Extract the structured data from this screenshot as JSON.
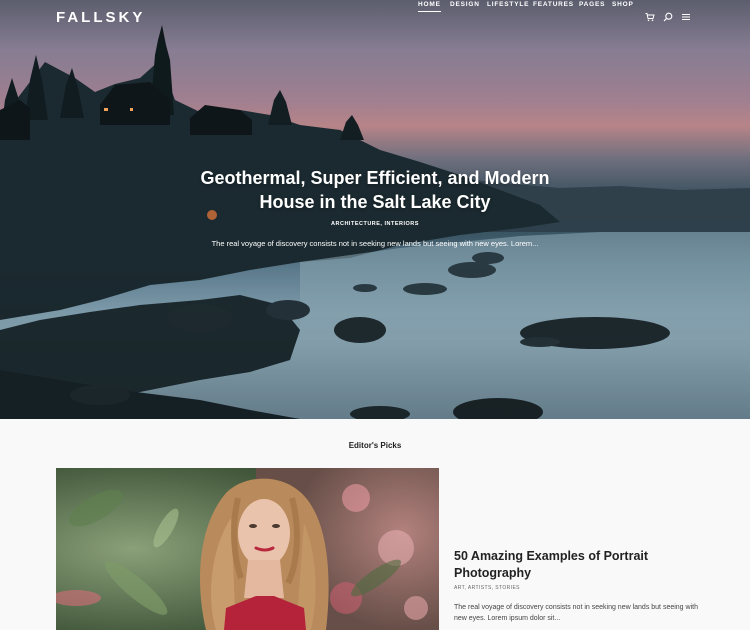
{
  "header": {
    "logo": "FALLSKY",
    "nav": [
      {
        "label": "HOME",
        "active": true
      },
      {
        "label": "DESIGN",
        "active": false
      },
      {
        "label": "LIFESTYLE",
        "active": false
      },
      {
        "label": "FEATURES",
        "active": false
      },
      {
        "label": "PAGES",
        "active": false
      },
      {
        "label": "SHOP",
        "active": false
      }
    ],
    "icons": [
      "cart-icon",
      "search-icon",
      "menu-icon"
    ]
  },
  "hero": {
    "title_line1": "Geothermal, Super Efficient, and Modern",
    "title_line2": "House in the Salt Lake City",
    "categories": "ARCHITECTURE, INTERIORS",
    "excerpt": "The real voyage of discovery consists not in seeking new lands but seeing with new eyes. Lorem..."
  },
  "editors_picks": {
    "heading": "Editor's Picks",
    "post": {
      "title": "50 Amazing Examples of Portrait Photography",
      "categories": "ART, ARTISTS, STORIES",
      "excerpt": "The real voyage of discovery consists not in seeking new lands but seeing with new eyes. Lorem ipsum dolor sit..."
    }
  },
  "colors": {
    "accent": "#ffffff",
    "background": "#f9f9f9",
    "text": "#222222"
  }
}
